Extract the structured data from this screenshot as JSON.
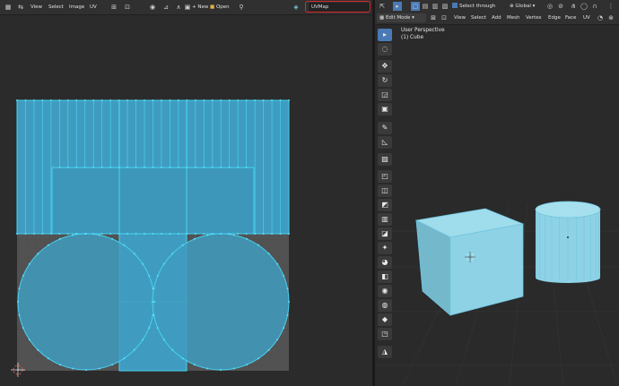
{
  "uv_editor": {
    "menus": [
      "View",
      "Select",
      "Image",
      "UV"
    ],
    "new_label": "New",
    "open_label": "Open",
    "uvmap_field": "UVMap"
  },
  "viewport": {
    "mode": "Edit Mode",
    "menus": [
      "View",
      "Select",
      "Add",
      "Mesh",
      "Vertex",
      "Edge",
      "Face",
      "UV"
    ],
    "select_through_label": "Select through",
    "orientation": "Global",
    "overlay_title": "User Perspective",
    "overlay_object": "(1) Cube"
  },
  "colors": {
    "uv_fill": "#3f9cc0",
    "uv_edge": "#48d0f0",
    "annotation": "#d52b2b",
    "object": "#8ed2e6"
  }
}
